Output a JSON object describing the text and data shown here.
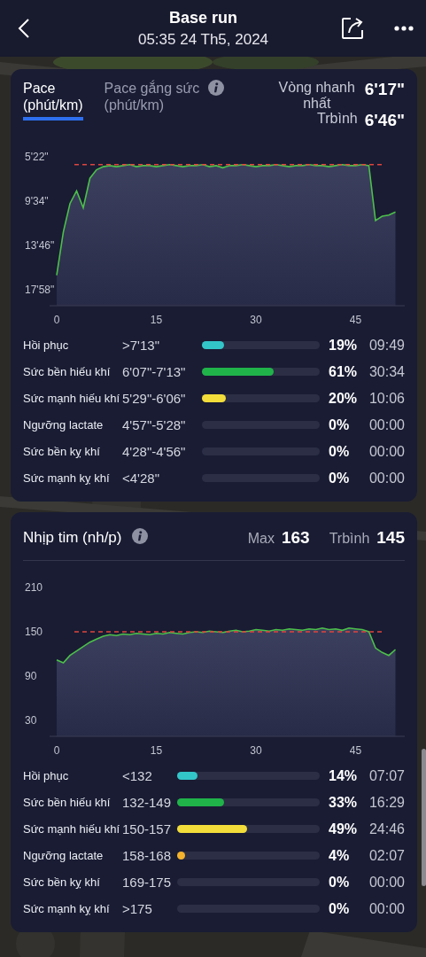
{
  "header": {
    "title": "Base run",
    "subtitle": "05:35 24 Th5, 2024"
  },
  "pace_card": {
    "tabs": [
      {
        "label": "Pace",
        "unit": "(phút/km)",
        "selected": true,
        "info_icon": false
      },
      {
        "label": "Pace gắng sức",
        "unit": "(phút/km)",
        "selected": false,
        "info_icon": true
      }
    ],
    "stats": [
      {
        "label": "Vòng nhanh nhất",
        "value": "6'17\""
      },
      {
        "label": "Trbình",
        "value": "6'46\""
      }
    ],
    "y_labels": [
      "5'22\"",
      "9'34\"",
      "13'46\"",
      "17'58\""
    ],
    "x_labels": [
      "0",
      "15",
      "30",
      "45"
    ],
    "zones": [
      {
        "name": "Hồi phục",
        "range": ">7'13\"",
        "level": 0.19,
        "color": "#33c6c9",
        "percent": "19%",
        "time": "09:49"
      },
      {
        "name": "Sức bền hiếu khí",
        "range": "6'07\"-7'13\"",
        "level": 0.61,
        "color": "#20b34a",
        "percent": "61%",
        "time": "30:34"
      },
      {
        "name": "Sức mạnh hiếu khí",
        "range": "5'29\"-6'06\"",
        "level": 0.2,
        "color": "#f3dd3a",
        "percent": "20%",
        "time": "10:06"
      },
      {
        "name": "Ngưỡng lactate",
        "range": "4'57\"-5'28\"",
        "percent": "0%",
        "time": "00:00"
      },
      {
        "name": "Sức bền kỵ khí",
        "range": "4'28\"-4'56\"",
        "percent": "0%",
        "time": "00:00"
      },
      {
        "name": "Sức mạnh kỵ khí",
        "range": "<4'28\"",
        "percent": "0%",
        "time": "00:00"
      }
    ]
  },
  "hr_card": {
    "title": "Nhịp tim (nh/p)",
    "stats": [
      {
        "label": "Max",
        "value": "163"
      },
      {
        "label": "Trbình",
        "value": "145"
      }
    ],
    "y_labels": [
      "210",
      "150",
      "90",
      "30"
    ],
    "x_labels": [
      "0",
      "15",
      "30",
      "45"
    ],
    "zones": [
      {
        "name": "Hồi phục",
        "range": "<132",
        "level": 0.14,
        "color": "#33c6c9",
        "percent": "14%",
        "time": "07:07"
      },
      {
        "name": "Sức bền hiếu khí",
        "range": "132-149",
        "level": 0.33,
        "color": "#20b34a",
        "percent": "33%",
        "time": "16:29"
      },
      {
        "name": "Sức mạnh hiếu khí",
        "range": "150-157",
        "level": 0.49,
        "color": "#f3dd3a",
        "percent": "49%",
        "time": "24:46"
      },
      {
        "name": "Ngưỡng lactate",
        "range": "158-168",
        "level": 0.04,
        "color": "#f4b32c",
        "percent": "4%",
        "time": "02:07"
      },
      {
        "name": "Sức bền kỵ khí",
        "range": "169-175",
        "percent": "0%",
        "time": "00:00"
      },
      {
        "name": "Sức mạnh kỵ khí",
        "range": ">175",
        "percent": "0%",
        "time": "00:00"
      }
    ]
  }
}
